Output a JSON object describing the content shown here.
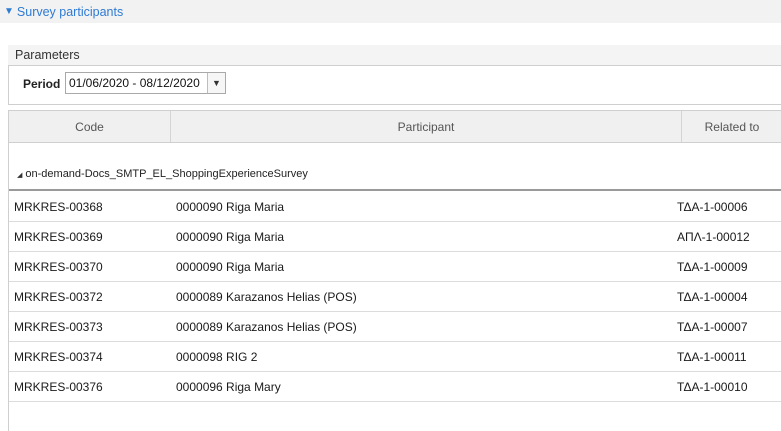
{
  "section": {
    "title": "Survey participants",
    "accent_color": "#2e7bd4"
  },
  "parameters": {
    "title": "Parameters",
    "period_label": "Period",
    "period_value": "01/06/2020 - 08/12/2020"
  },
  "grid": {
    "columns": [
      "Code",
      "Participant",
      "Related to"
    ],
    "group_label": "on-demand-Docs_SMTP_EL_ShoppingExperienceSurvey",
    "rows": [
      {
        "code": "MRKRES-00368",
        "participant": "0000090 Riga Maria",
        "related": "ΤΔΑ-1-00006"
      },
      {
        "code": "MRKRES-00369",
        "participant": "0000090 Riga Maria",
        "related": "ΑΠΛ-1-00012"
      },
      {
        "code": "MRKRES-00370",
        "participant": "0000090 Riga Maria",
        "related": "ΤΔΑ-1-00009"
      },
      {
        "code": "MRKRES-00372",
        "participant": "0000089 Karazanos Helias (POS)",
        "related": "ΤΔΑ-1-00004"
      },
      {
        "code": "MRKRES-00373",
        "participant": "0000089 Karazanos Helias (POS)",
        "related": "ΤΔΑ-1-00007"
      },
      {
        "code": "MRKRES-00374",
        "participant": "0000098 RIG 2",
        "related": "ΤΔΑ-1-00011"
      },
      {
        "code": "MRKRES-00376",
        "participant": "0000096 Riga Mary",
        "related": "ΤΔΑ-1-00010"
      }
    ]
  }
}
